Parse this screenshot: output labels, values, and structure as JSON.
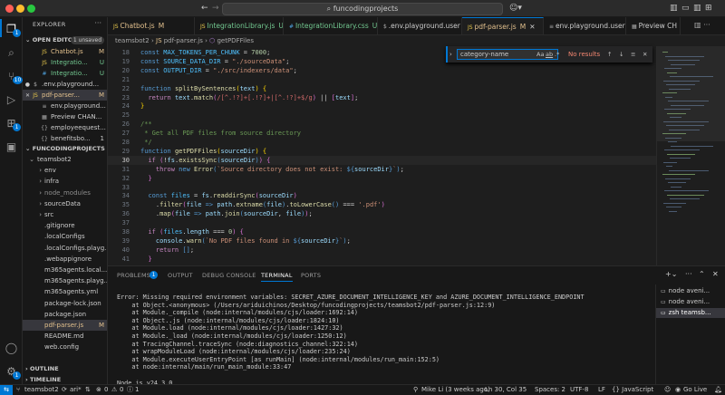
{
  "window": {
    "search": "funcodingprojects",
    "traffic_colors": [
      "#ff5f57",
      "#febc2e",
      "#28c840"
    ]
  },
  "activity_bar": {
    "items": [
      {
        "name": "explorer",
        "badge": "1"
      },
      {
        "name": "search",
        "badge": ""
      },
      {
        "name": "source-control",
        "badge": "10"
      },
      {
        "name": "run-debug",
        "badge": ""
      },
      {
        "name": "extensions",
        "badge": "1"
      },
      {
        "name": "remote",
        "badge": ""
      }
    ],
    "bottom": [
      "account",
      "settings"
    ],
    "settings_badge": "1"
  },
  "sidebar": {
    "title": "EXPLORER",
    "open_editors": {
      "label": "OPEN EDITO...",
      "badge": "1 unsaved",
      "items": [
        {
          "name": "Chatbot.js",
          "status": "M",
          "icon": "JS",
          "color": "#e2c08d",
          "indent": 20
        },
        {
          "name": "Integratio...",
          "status": "U",
          "icon": "JS",
          "color": "#73c991",
          "indent": 20
        },
        {
          "name": "Integratio...",
          "status": "U",
          "icon": "#",
          "color": "#73c991",
          "indent": 20
        },
        {
          "name": ".env.playground...",
          "status": "",
          "icon": "$",
          "color": "#cccccc",
          "indent": 10,
          "dot": true
        },
        {
          "name": "pdf-parser...",
          "status": "M",
          "icon": "JS",
          "color": "#e2c08d",
          "indent": 10,
          "close": true,
          "selected": true
        },
        {
          "name": "env.playground...",
          "status": "",
          "icon": "≡",
          "color": "#cccccc",
          "indent": 20
        },
        {
          "name": "Preview CHAN...",
          "status": "",
          "icon": "▦",
          "color": "#cccccc",
          "indent": 20
        },
        {
          "name": "employeequest...",
          "status": "",
          "icon": "{}",
          "color": "#cccccc",
          "indent": 20
        },
        {
          "name": "benefitsbo...",
          "status": "1",
          "icon": "{}",
          "color": "#cccccc",
          "indent": 20
        }
      ]
    },
    "workspace": {
      "label": "FUNCODINGPROJECTS",
      "items": [
        {
          "name": "teamsbot2",
          "type": "folder-open",
          "indent": 8,
          "color": "#cccccc",
          "status": ""
        },
        {
          "name": "env",
          "type": "folder",
          "indent": 16,
          "color": "#cccccc",
          "status": ""
        },
        {
          "name": "infra",
          "type": "folder",
          "indent": 16,
          "color": "#cccccc",
          "status": ""
        },
        {
          "name": "node_modules",
          "type": "folder",
          "indent": 16,
          "color": "#8c8c8c",
          "status": ""
        },
        {
          "name": "sourceData",
          "type": "folder",
          "indent": 16,
          "color": "#cccccc",
          "status": ""
        },
        {
          "name": "src",
          "type": "folder",
          "indent": 16,
          "color": "#cccccc",
          "status": ""
        },
        {
          "name": ".gitignore",
          "type": "file",
          "indent": 16,
          "color": "#cccccc",
          "status": ""
        },
        {
          "name": ".localConfigs",
          "type": "file",
          "indent": 16,
          "color": "#cccccc",
          "status": ""
        },
        {
          "name": ".localConfigs.playg...",
          "type": "file",
          "indent": 16,
          "color": "#cccccc",
          "status": ""
        },
        {
          "name": ".webappignore",
          "type": "file",
          "indent": 16,
          "color": "#cccccc",
          "status": ""
        },
        {
          "name": "m365agents.local....",
          "type": "file",
          "indent": 16,
          "color": "#cccccc",
          "status": ""
        },
        {
          "name": "m365agents.playg...",
          "type": "file",
          "indent": 16,
          "color": "#cccccc",
          "status": ""
        },
        {
          "name": "m365agents.yml",
          "type": "file",
          "indent": 16,
          "color": "#cccccc",
          "status": ""
        },
        {
          "name": "package-lock.json",
          "type": "file",
          "indent": 16,
          "color": "#cccccc",
          "status": ""
        },
        {
          "name": "package.json",
          "type": "file",
          "indent": 16,
          "color": "#cccccc",
          "status": ""
        },
        {
          "name": "pdf-parser.js",
          "type": "file",
          "indent": 16,
          "color": "#e2c08d",
          "status": "M"
        },
        {
          "name": "README.md",
          "type": "file",
          "indent": 16,
          "color": "#cccccc",
          "status": ""
        },
        {
          "name": "web.config",
          "type": "file",
          "indent": 16,
          "color": "#cccccc",
          "status": ""
        }
      ]
    },
    "outline": "OUTLINE",
    "timeline": "TIMELINE"
  },
  "tabs": [
    {
      "label": "Chatbot.js",
      "status": "M",
      "icon": "JS",
      "color": "#e2c08d"
    },
    {
      "label": "IntegrationLibrary.js",
      "status": "U",
      "icon": "JS",
      "color": "#73c991"
    },
    {
      "label": "IntegrationLibrary.css",
      "status": "U",
      "icon": "#",
      "color": "#73c991"
    },
    {
      "label": ".env.playground.user",
      "status": "",
      "icon": "$",
      "color": "#cccccc"
    },
    {
      "label": "pdf-parser.js",
      "status": "M",
      "icon": "JS",
      "color": "#e2c08d",
      "active": true
    },
    {
      "label": "env.playground.user",
      "status": "",
      "icon": "≡",
      "color": "#cccccc"
    },
    {
      "label": "Preview CH",
      "status": "",
      "icon": "▦",
      "color": "#cccccc"
    }
  ],
  "breadcrumb": [
    "teamsbot2",
    "pdf-parser.js",
    "getPDFFiles"
  ],
  "find": {
    "query": "category-name",
    "options": [
      "Aa",
      "ab",
      ".*"
    ],
    "result": "No results"
  },
  "editor": {
    "current_line": 30,
    "lines": [
      {
        "n": 18,
        "code": [
          [
            "k",
            "const "
          ],
          [
            "cst",
            "MAX_TOKENS_PER_CHUNK"
          ],
          [
            "d",
            " = "
          ],
          [
            "n",
            "7000"
          ],
          [
            "d",
            ";"
          ]
        ]
      },
      {
        "n": 19,
        "code": [
          [
            "k",
            "const "
          ],
          [
            "cst",
            "SOURCE_DATA_DIR"
          ],
          [
            "d",
            " = "
          ],
          [
            "s",
            "\"./sourceData\""
          ],
          [
            "d",
            ";"
          ]
        ]
      },
      {
        "n": 20,
        "code": [
          [
            "k",
            "const "
          ],
          [
            "cst",
            "OUTPUT_DIR"
          ],
          [
            "d",
            " = "
          ],
          [
            "s",
            "\"./src/indexers/data\""
          ],
          [
            "d",
            ";"
          ]
        ]
      },
      {
        "n": 21,
        "code": []
      },
      {
        "n": 22,
        "code": [
          [
            "k",
            "function "
          ],
          [
            "f",
            "splitBySentences"
          ],
          [
            "y",
            "("
          ],
          [
            "v",
            "text"
          ],
          [
            "y",
            ")"
          ],
          [
            "d",
            " "
          ],
          [
            "y",
            "{"
          ]
        ]
      },
      {
        "n": 23,
        "code": [
          [
            "d",
            "  "
          ],
          [
            "ctl",
            "return "
          ],
          [
            "v",
            "text"
          ],
          [
            "d",
            "."
          ],
          [
            "f",
            "match"
          ],
          [
            "pu",
            "("
          ],
          [
            "r",
            "/[^.!?]+[.!?]+|[^.!?]+$/g"
          ],
          [
            "pu",
            ")"
          ],
          [
            "d",
            " || "
          ],
          [
            "pu",
            "["
          ],
          [
            "v",
            "text"
          ],
          [
            "pu",
            "]"
          ],
          [
            "d",
            ";"
          ]
        ]
      },
      {
        "n": 24,
        "code": [
          [
            "y",
            "}"
          ]
        ]
      },
      {
        "n": 25,
        "code": []
      },
      {
        "n": 26,
        "code": [
          [
            "c",
            "/**"
          ]
        ]
      },
      {
        "n": 27,
        "code": [
          [
            "c",
            " * Get all PDF files from source directory"
          ]
        ]
      },
      {
        "n": 28,
        "code": [
          [
            "c",
            " */"
          ]
        ]
      },
      {
        "n": 29,
        "code": [
          [
            "k",
            "function "
          ],
          [
            "f",
            "getPDFFiles"
          ],
          [
            "y",
            "("
          ],
          [
            "v",
            "sourceDir"
          ],
          [
            "y",
            ")"
          ],
          [
            "d",
            " "
          ],
          [
            "y",
            "{"
          ]
        ]
      },
      {
        "n": 30,
        "code": [
          [
            "d",
            "  "
          ],
          [
            "ctl",
            "if "
          ],
          [
            "pu",
            "("
          ],
          [
            "d",
            "!"
          ],
          [
            "v",
            "fs"
          ],
          [
            "d",
            "."
          ],
          [
            "f",
            "existsSync"
          ],
          [
            "k",
            "("
          ],
          [
            "v",
            "sourceDir"
          ],
          [
            "k",
            ")"
          ],
          [
            "pu",
            ")"
          ],
          [
            "d",
            " "
          ],
          [
            "pu",
            "{"
          ]
        ]
      },
      {
        "n": 31,
        "code": [
          [
            "d",
            "    "
          ],
          [
            "ctl",
            "throw "
          ],
          [
            "k",
            "new "
          ],
          [
            "f",
            "Error"
          ],
          [
            "k",
            "("
          ],
          [
            "s",
            "`Source directory does not exist: "
          ],
          [
            "k",
            "${"
          ],
          [
            "v",
            "sourceDir"
          ],
          [
            "k",
            "}"
          ],
          [
            "s",
            "`"
          ],
          [
            "k",
            ")"
          ],
          [
            "d",
            ";"
          ]
        ]
      },
      {
        "n": 32,
        "code": [
          [
            "d",
            "  "
          ],
          [
            "pu",
            "}"
          ]
        ]
      },
      {
        "n": 33,
        "code": []
      },
      {
        "n": 34,
        "code": [
          [
            "d",
            "  "
          ],
          [
            "k",
            "const "
          ],
          [
            "cst",
            "files"
          ],
          [
            "d",
            " = "
          ],
          [
            "v",
            "fs"
          ],
          [
            "d",
            "."
          ],
          [
            "f",
            "readdirSync"
          ],
          [
            "pu",
            "("
          ],
          [
            "v",
            "sourceDir"
          ],
          [
            "pu",
            ")"
          ]
        ]
      },
      {
        "n": 35,
        "code": [
          [
            "d",
            "    ."
          ],
          [
            "f",
            "filter"
          ],
          [
            "pu",
            "("
          ],
          [
            "v",
            "file"
          ],
          [
            "d",
            " "
          ],
          [
            "k",
            "=>"
          ],
          [
            "d",
            " "
          ],
          [
            "v",
            "path"
          ],
          [
            "d",
            "."
          ],
          [
            "f",
            "extname"
          ],
          [
            "k",
            "("
          ],
          [
            "v",
            "file"
          ],
          [
            "k",
            ")"
          ],
          [
            "d",
            "."
          ],
          [
            "f",
            "toLowerCase"
          ],
          [
            "k",
            "()"
          ],
          [
            "d",
            " === "
          ],
          [
            "s",
            "'.pdf'"
          ],
          [
            "pu",
            ")"
          ]
        ]
      },
      {
        "n": 36,
        "code": [
          [
            "d",
            "    ."
          ],
          [
            "f",
            "map"
          ],
          [
            "pu",
            "("
          ],
          [
            "v",
            "file"
          ],
          [
            "d",
            " "
          ],
          [
            "k",
            "=>"
          ],
          [
            "d",
            " "
          ],
          [
            "v",
            "path"
          ],
          [
            "d",
            "."
          ],
          [
            "f",
            "join"
          ],
          [
            "k",
            "("
          ],
          [
            "v",
            "sourceDir"
          ],
          [
            "d",
            ", "
          ],
          [
            "v",
            "file"
          ],
          [
            "k",
            ")"
          ],
          [
            "pu",
            ")"
          ],
          [
            "d",
            ";"
          ]
        ]
      },
      {
        "n": 37,
        "code": []
      },
      {
        "n": 38,
        "code": [
          [
            "d",
            "  "
          ],
          [
            "ctl",
            "if "
          ],
          [
            "pu",
            "("
          ],
          [
            "cst",
            "files"
          ],
          [
            "d",
            "."
          ],
          [
            "v",
            "length"
          ],
          [
            "d",
            " === "
          ],
          [
            "n",
            "0"
          ],
          [
            "pu",
            ")"
          ],
          [
            "d",
            " "
          ],
          [
            "pu",
            "{"
          ]
        ]
      },
      {
        "n": 39,
        "code": [
          [
            "d",
            "    "
          ],
          [
            "v",
            "console"
          ],
          [
            "d",
            "."
          ],
          [
            "f",
            "warn"
          ],
          [
            "k",
            "("
          ],
          [
            "s",
            "`No PDF files found in "
          ],
          [
            "k",
            "${"
          ],
          [
            "v",
            "sourceDir"
          ],
          [
            "k",
            "}"
          ],
          [
            "s",
            "`"
          ],
          [
            "k",
            ")"
          ],
          [
            "d",
            ";"
          ]
        ]
      },
      {
        "n": 40,
        "code": [
          [
            "d",
            "    "
          ],
          [
            "ctl",
            "return "
          ],
          [
            "k",
            "[]"
          ],
          [
            "d",
            ";"
          ]
        ]
      },
      {
        "n": 41,
        "code": [
          [
            "d",
            "  "
          ],
          [
            "pu",
            "}"
          ]
        ]
      }
    ]
  },
  "panel": {
    "tabs": [
      "PROBLEMS",
      "OUTPUT",
      "DEBUG CONSOLE",
      "TERMINAL",
      "PORTS"
    ],
    "problems_badge": "1",
    "active_tab": "TERMINAL",
    "terminal_lines": [
      "Error: Missing required environment variables: SECRET_AZURE_DOCUMENT_INTELLIGENCE_KEY and AZURE_DOCUMENT_INTELLIGENCE_ENDPOINT",
      "    at Object.<anonymous> (/Users/ariduichinos/Desktop/funcodingprojects/teamsbot2/pdf-parser.js:12:9)",
      "    at Module._compile (node:internal/modules/cjs/loader:1692:14)",
      "    at Object..js (node:internal/modules/cjs/loader:1824:10)",
      "    at Module.load (node:internal/modules/cjs/loader:1427:32)",
      "    at Module._load (node:internal/modules/cjs/loader:1250:12)",
      "    at TracingChannel.traceSync (node:diagnostics_channel:322:14)",
      "    at wrapModuleLoad (node:internal/modules/cjs/loader:235:24)",
      "    at Module.executeUserEntryPoint [as runMain] (node:internal/modules/run_main:152:5)",
      "    at node:internal/main/run_main_module:33:47",
      "",
      "Node.js v24.3.0",
      "aridulchinos@Aris-MacBook-Pro teamsbot2 % node pdf-parser.js"
    ],
    "sessions": [
      {
        "label": "node aveni...",
        "selected": false
      },
      {
        "label": "node aveni...",
        "selected": false
      },
      {
        "label": "zsh teamsb...",
        "selected": true
      }
    ]
  },
  "statusbar": {
    "branch": "teamsbot2",
    "sync": "ari*",
    "errors": "0",
    "warnings": "0",
    "info": "1",
    "blame": "Mike Li (3 weeks ago)",
    "position": "Ln 30, Col 35",
    "spaces": "Spaces: 2",
    "encoding": "UTF-8",
    "eol": "LF",
    "language": "{} JavaScript",
    "golive": "Go Live"
  }
}
